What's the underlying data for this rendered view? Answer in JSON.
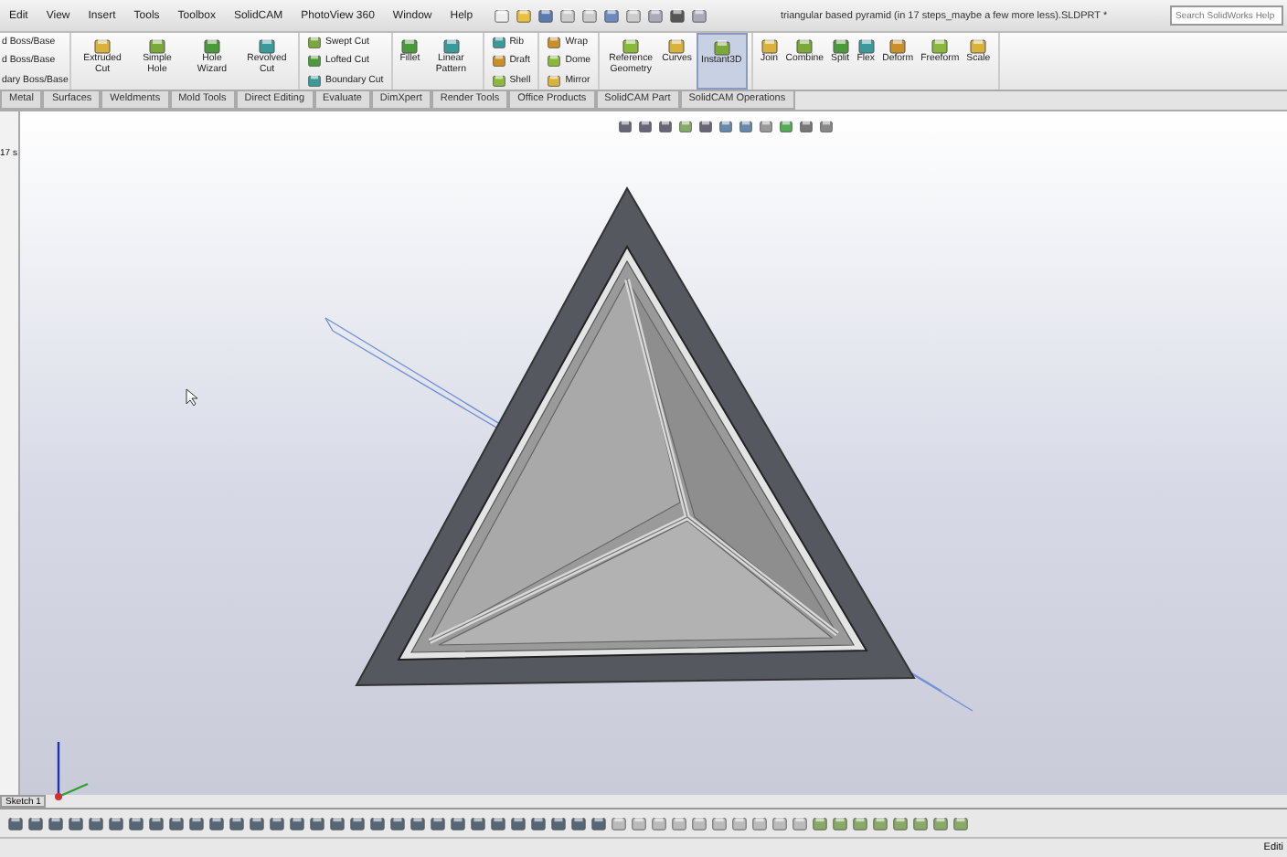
{
  "menu": {
    "items": [
      "Edit",
      "View",
      "Insert",
      "Tools",
      "Toolbox",
      "SolidCAM",
      "PhotoView 360",
      "Window",
      "Help"
    ]
  },
  "window": {
    "title": "triangular based pyramid (in 17 steps_maybe a few more less).SLDPRT *"
  },
  "search": {
    "placeholder": "Search SolidWorks Help"
  },
  "ribbon": {
    "cut_column": [
      "d Boss/Base",
      "d Boss/Base",
      "dary Boss/Base"
    ],
    "groups": [
      {
        "kind": "large",
        "buttons": [
          {
            "label": "Extruded Cut",
            "selected": false
          },
          {
            "label": "Simple Hole",
            "selected": false
          },
          {
            "label": "Hole Wizard",
            "selected": false
          },
          {
            "label": "Revolved Cut",
            "selected": false
          }
        ]
      },
      {
        "kind": "small",
        "buttons": [
          {
            "label": "Swept Cut",
            "selected": false
          },
          {
            "label": "Lofted Cut",
            "selected": false
          },
          {
            "label": "Boundary Cut",
            "selected": false
          }
        ]
      },
      {
        "kind": "large",
        "buttons": [
          {
            "label": "Fillet",
            "selected": false
          },
          {
            "label": "Linear Pattern",
            "selected": false
          }
        ]
      },
      {
        "kind": "small",
        "buttons": [
          {
            "label": "Rib",
            "selected": false
          },
          {
            "label": "Draft",
            "selected": false
          },
          {
            "label": "Shell",
            "selected": false
          }
        ]
      },
      {
        "kind": "small",
        "buttons": [
          {
            "label": "Wrap",
            "selected": false
          },
          {
            "label": "Dome",
            "selected": false
          },
          {
            "label": "Mirror",
            "selected": false
          }
        ]
      },
      {
        "kind": "large",
        "buttons": [
          {
            "label": "Reference Geometry",
            "selected": false
          },
          {
            "label": "Curves",
            "selected": false
          },
          {
            "label": "Instant3D",
            "selected": true
          }
        ]
      },
      {
        "kind": "large",
        "buttons": [
          {
            "label": "Join",
            "selected": false
          },
          {
            "label": "Combine",
            "selected": false
          },
          {
            "label": "Split",
            "selected": false
          },
          {
            "label": "Flex",
            "selected": false
          },
          {
            "label": "Deform",
            "selected": false
          },
          {
            "label": "Freeform",
            "selected": false
          },
          {
            "label": "Scale",
            "selected": false
          }
        ]
      }
    ]
  },
  "tabs": [
    {
      "label": "Metal",
      "selected": false
    },
    {
      "label": "Surfaces",
      "selected": false
    },
    {
      "label": "Weldments",
      "selected": false
    },
    {
      "label": "Mold Tools",
      "selected": false
    },
    {
      "label": "Direct Editing",
      "selected": false
    },
    {
      "label": "Evaluate",
      "selected": false
    },
    {
      "label": "DimXpert",
      "selected": false
    },
    {
      "label": "Render Tools",
      "selected": false
    },
    {
      "label": "Office Products",
      "selected": false
    },
    {
      "label": "SolidCAM Part",
      "selected": false
    },
    {
      "label": "SolidCAM Operations",
      "selected": false
    }
  ],
  "tree_panel": {
    "text": "17 s"
  },
  "bottom_tab": {
    "label": "Sketch 1"
  },
  "status_bar": {
    "right": "Editi"
  }
}
